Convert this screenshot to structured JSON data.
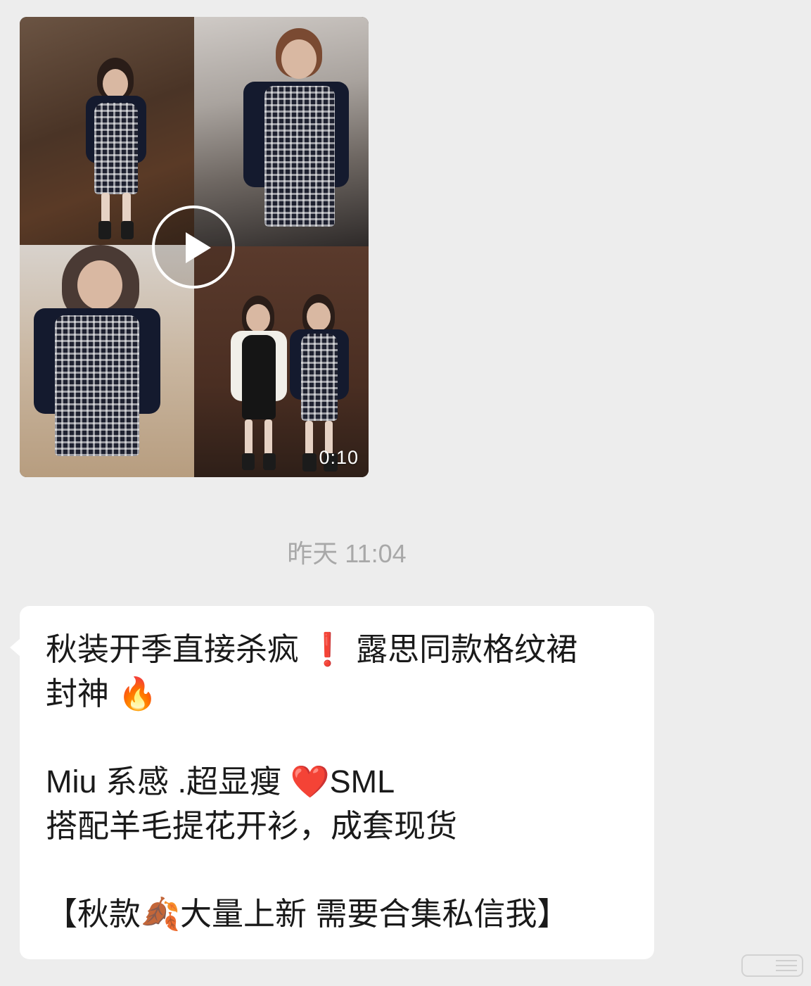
{
  "video": {
    "duration": "0:10",
    "play_icon": "play-icon"
  },
  "timestamp": "昨天 11:04",
  "message": {
    "line1_text": "秋装开季直接杀疯",
    "line1_emoji": "❗",
    "line1_text2": " 露思同款格纹裙",
    "line2_text": "封神",
    "line2_emoji": "🔥",
    "line3_text": "Miu 系感 .超显瘦 ",
    "line3_emoji": "❤️",
    "line3_text2": "SML",
    "line4_text": "搭配羊毛提花开衫，成套现货",
    "line5_text": "【秋款",
    "line5_emoji": "🍂",
    "line5_text2": "大量上新 需要合集私信我】"
  },
  "colors": {
    "background": "#ededed",
    "bubble": "#ffffff",
    "timestamp": "#a8a8a8",
    "text": "#1a1a1a",
    "emoji_red": "#e0242b",
    "emoji_fire": "#f27a1a",
    "emoji_leaf": "#b4561d"
  }
}
